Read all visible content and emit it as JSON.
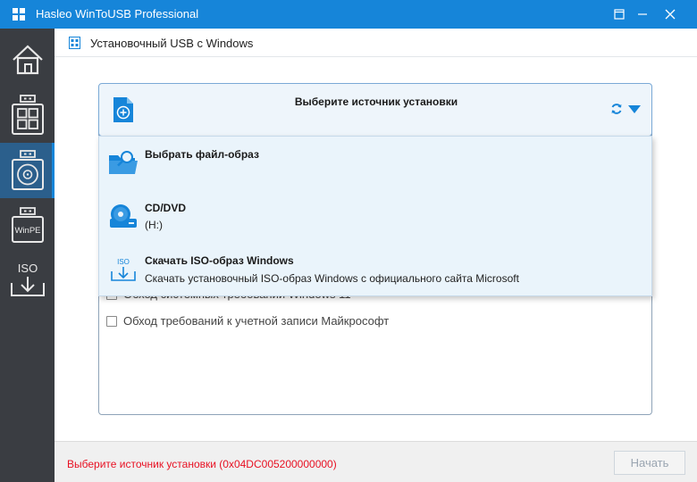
{
  "window": {
    "title": "Hasleo WinToUSB Professional",
    "controls": [
      "restore-icon",
      "minimize-icon",
      "close-icon"
    ]
  },
  "sidebar": {
    "items": [
      {
        "id": "home",
        "icon": "home-icon"
      },
      {
        "id": "windows-usb",
        "icon": "windows-usb-icon"
      },
      {
        "id": "install-usb",
        "icon": "disc-usb-icon",
        "active": true
      },
      {
        "id": "winpe",
        "icon": "winpe-icon",
        "label": "WinPE"
      },
      {
        "id": "iso",
        "icon": "iso-download-icon",
        "label": "ISO"
      }
    ]
  },
  "header": {
    "title": "Установочный USB с Windows",
    "icon": "grid-icon"
  },
  "source": {
    "title": "Выберите источник установки",
    "icon": "add-document-icon",
    "refresh_icon": "refresh-icon",
    "dropdown_icon": "caret-down-icon"
  },
  "dropdown": {
    "items": [
      {
        "title": "Выбрать файл-образ",
        "subtitle": "",
        "icon": "folder-search-icon"
      },
      {
        "title": "CD/DVD",
        "subtitle": "(H:)",
        "icon": "cd-drive-icon"
      },
      {
        "title": "Скачать ISO-образ Windows",
        "subtitle": "Скачать установочный ISO-образ Windows с официального сайта Microsoft",
        "icon": "iso-download-icon",
        "icon_label": "ISO"
      }
    ]
  },
  "options": [
    {
      "label": "Обход системных требований Windows 11",
      "checked": false,
      "partially_hidden": true
    },
    {
      "label": "Обход требований к учетной записи Майкрософт",
      "checked": false
    }
  ],
  "footer": {
    "status": "Выберите источник установки (0x04DC005200000000)",
    "next_label": "Начать",
    "next_enabled": false
  },
  "colors": {
    "accent": "#1685d9",
    "sidebar_bg": "#3a3d42",
    "sidebar_active": "#2b5f8c",
    "error": "#e81123",
    "dropdown_bg": "#eaf4fb"
  }
}
